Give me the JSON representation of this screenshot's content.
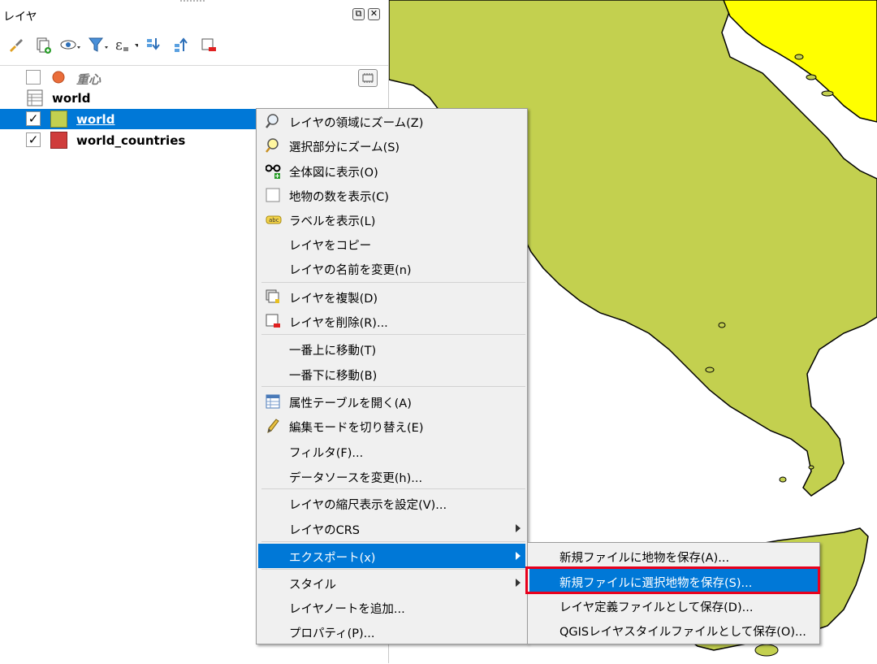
{
  "colors": {
    "land": "#c3d04f",
    "highlight_land": "#ffff00",
    "selection": "#0078d7",
    "country_red": "#cf3c3b"
  },
  "panel": {
    "title": "レイヤ",
    "toolbar_icons": [
      "style-brush-icon",
      "add-group-icon",
      "visibility-eye-icon",
      "filter-icon",
      "expression-filter-icon",
      "expand-all-icon",
      "collapse-all-icon",
      "remove-layer-icon"
    ]
  },
  "layers": [
    {
      "label": "重心",
      "checked": false,
      "symbol": "orange-circle"
    },
    {
      "label": "world",
      "checked": null,
      "symbol": "table"
    },
    {
      "label": "world",
      "checked": true,
      "symbol": "green-square",
      "selected": true
    },
    {
      "label": "world_countries",
      "checked": true,
      "symbol": "red-square"
    }
  ],
  "context_menu": {
    "items": [
      {
        "label": "レイヤの領域にズーム(Z)",
        "icon": "zoom-layer-icon"
      },
      {
        "label": "選択部分にズーム(S)",
        "icon": "zoom-selection-icon"
      },
      {
        "label": "全体図に表示(O)",
        "icon": "overview-glasses-icon"
      },
      {
        "label": "地物の数を表示(C)",
        "icon": "checkbox-icon"
      },
      {
        "label": "ラベルを表示(L)",
        "icon": "label-abc-icon"
      },
      {
        "label": "レイヤをコピー",
        "icon": ""
      },
      {
        "label": "レイヤの名前を変更(n)",
        "icon": ""
      },
      {
        "label": "レイヤを複製(D)",
        "icon": "duplicate-layer-icon"
      },
      {
        "label": "レイヤを削除(R)...",
        "icon": "remove-layer-icon"
      },
      {
        "label": "一番上に移動(T)",
        "icon": ""
      },
      {
        "label": "一番下に移動(B)",
        "icon": ""
      },
      {
        "label": "属性テーブルを開く(A)",
        "icon": "attribute-table-icon"
      },
      {
        "label": "編集モードを切り替え(E)",
        "icon": "pencil-icon"
      },
      {
        "label": "フィルタ(F)...",
        "icon": ""
      },
      {
        "label": "データソースを変更(h)...",
        "icon": ""
      },
      {
        "label": "レイヤの縮尺表示を設定(V)...",
        "icon": ""
      },
      {
        "label": "レイヤのCRS",
        "icon": ""
      },
      {
        "label": "エクスポート(x)",
        "icon": ""
      },
      {
        "label": "スタイル",
        "icon": ""
      },
      {
        "label": "レイヤノートを追加...",
        "icon": ""
      },
      {
        "label": "プロパティ(P)...",
        "icon": ""
      }
    ]
  },
  "export_submenu": {
    "items": [
      {
        "label": "新規ファイルに地物を保存(A)..."
      },
      {
        "label": "新規ファイルに選択地物を保存(S)..."
      },
      {
        "label": "レイヤ定義ファイルとして保存(D)..."
      },
      {
        "label": "QGISレイヤスタイルファイルとして保存(O)..."
      }
    ]
  }
}
